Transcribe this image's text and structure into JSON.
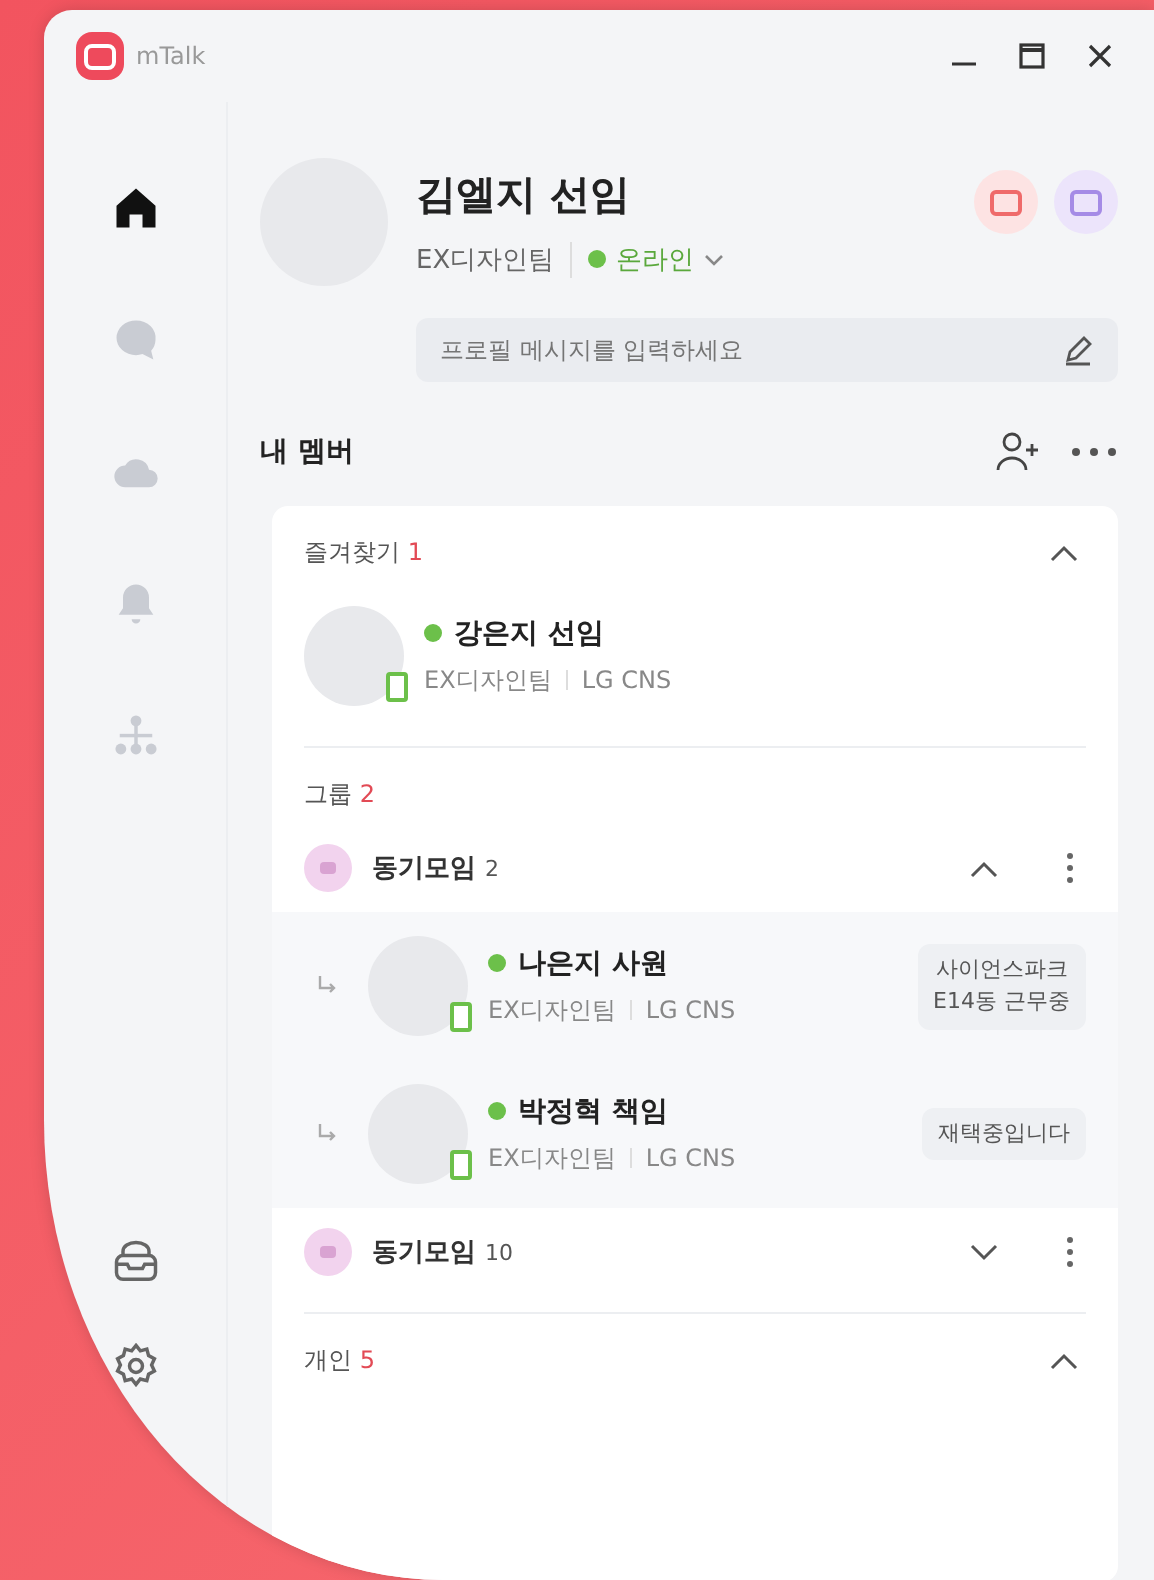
{
  "app": {
    "title": "mTalk"
  },
  "sidebar": {
    "top": [
      {
        "kind": "home",
        "selected": true
      },
      {
        "kind": "chat",
        "selected": false
      },
      {
        "kind": "cloud",
        "selected": false
      },
      {
        "kind": "bell",
        "selected": false
      },
      {
        "kind": "org",
        "selected": false
      }
    ],
    "bottom": [
      {
        "kind": "inbox",
        "selected": false
      },
      {
        "kind": "settings",
        "selected": false
      }
    ]
  },
  "profile": {
    "name": "김엘지 선임",
    "team": "EX디자인팀",
    "status": "온라인",
    "online": true,
    "message": {
      "placeholder": "프로필 메시지를 입력하세요"
    }
  },
  "members": {
    "title": "내 멤버",
    "favorites": {
      "label": "즐겨찾기",
      "count": "1",
      "expanded": true,
      "members": [
        {
          "name": "강은지 선임",
          "team": "EX디자인팀",
          "company": "LG CNS",
          "online": true
        }
      ]
    },
    "groups": {
      "label": "그룹",
      "count": "2",
      "items": [
        {
          "name": "동기모임",
          "count": "2",
          "expanded": true,
          "members": [
            {
              "name": "나은지 사원",
              "team": "EX디자인팀",
              "company": "LG CNS",
              "online": true,
              "status_message": "사이언스파크\nE14동 근무중"
            },
            {
              "name": "박정혁 책임",
              "team": "EX디자인팀",
              "company": "LG CNS",
              "online": true,
              "status_message": "재택중입니다"
            }
          ]
        },
        {
          "name": "동기모임",
          "count": "10",
          "expanded": false
        }
      ]
    },
    "personal": {
      "label": "개인",
      "count": "5",
      "expanded": true
    }
  }
}
